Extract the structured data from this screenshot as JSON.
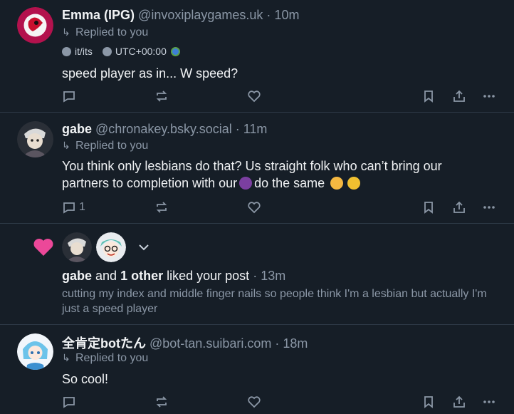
{
  "posts": [
    {
      "author_name": "Emma (IPG)",
      "handle": "@invoxiplaygames.uk",
      "separator": "·",
      "time": "10m",
      "replied_label": "Replied to you",
      "pronouns": "it/its",
      "timezone": "UTC+00:00",
      "text": "speed player as in... W speed?",
      "reply_count": "",
      "avatar_color": "#c2185b"
    },
    {
      "author_name": "gabe",
      "handle": "@chronakey.bsky.social",
      "separator": "·",
      "time": "11m",
      "replied_label": "Replied to you",
      "text_line1": "You think only lesbians do that? Us straight folk who can’t bring our",
      "text_line2_a": "partners to completion with our",
      "text_line2_b": "do the same",
      "reply_count": "1"
    },
    {
      "author_name": "全肯定botたん",
      "author_name_parts": [
        "全肯定",
        "bot",
        "たん"
      ],
      "handle": "@bot-tan.suibari.com",
      "separator": "·",
      "time": "18m",
      "replied_label": "Replied to you",
      "text": "So cool!",
      "reply_count": ""
    }
  ],
  "notification": {
    "actor": "gabe",
    "and": "and",
    "others": "1 other",
    "action": "liked your post",
    "separator": "·",
    "time": "13m",
    "body": "cutting my index and middle finger nails so people think I'm a lesbian but actually I'm just a speed player",
    "heart_color": "#ec4899"
  },
  "icons": [
    "reply-icon",
    "repost-icon",
    "like-icon",
    "bookmark-icon",
    "share-icon",
    "more-icon",
    "chevron-down-icon",
    "heart-icon"
  ],
  "colors": {
    "background": "#161e27",
    "muted": "#8b97a6",
    "divider": "#2e3a47"
  }
}
